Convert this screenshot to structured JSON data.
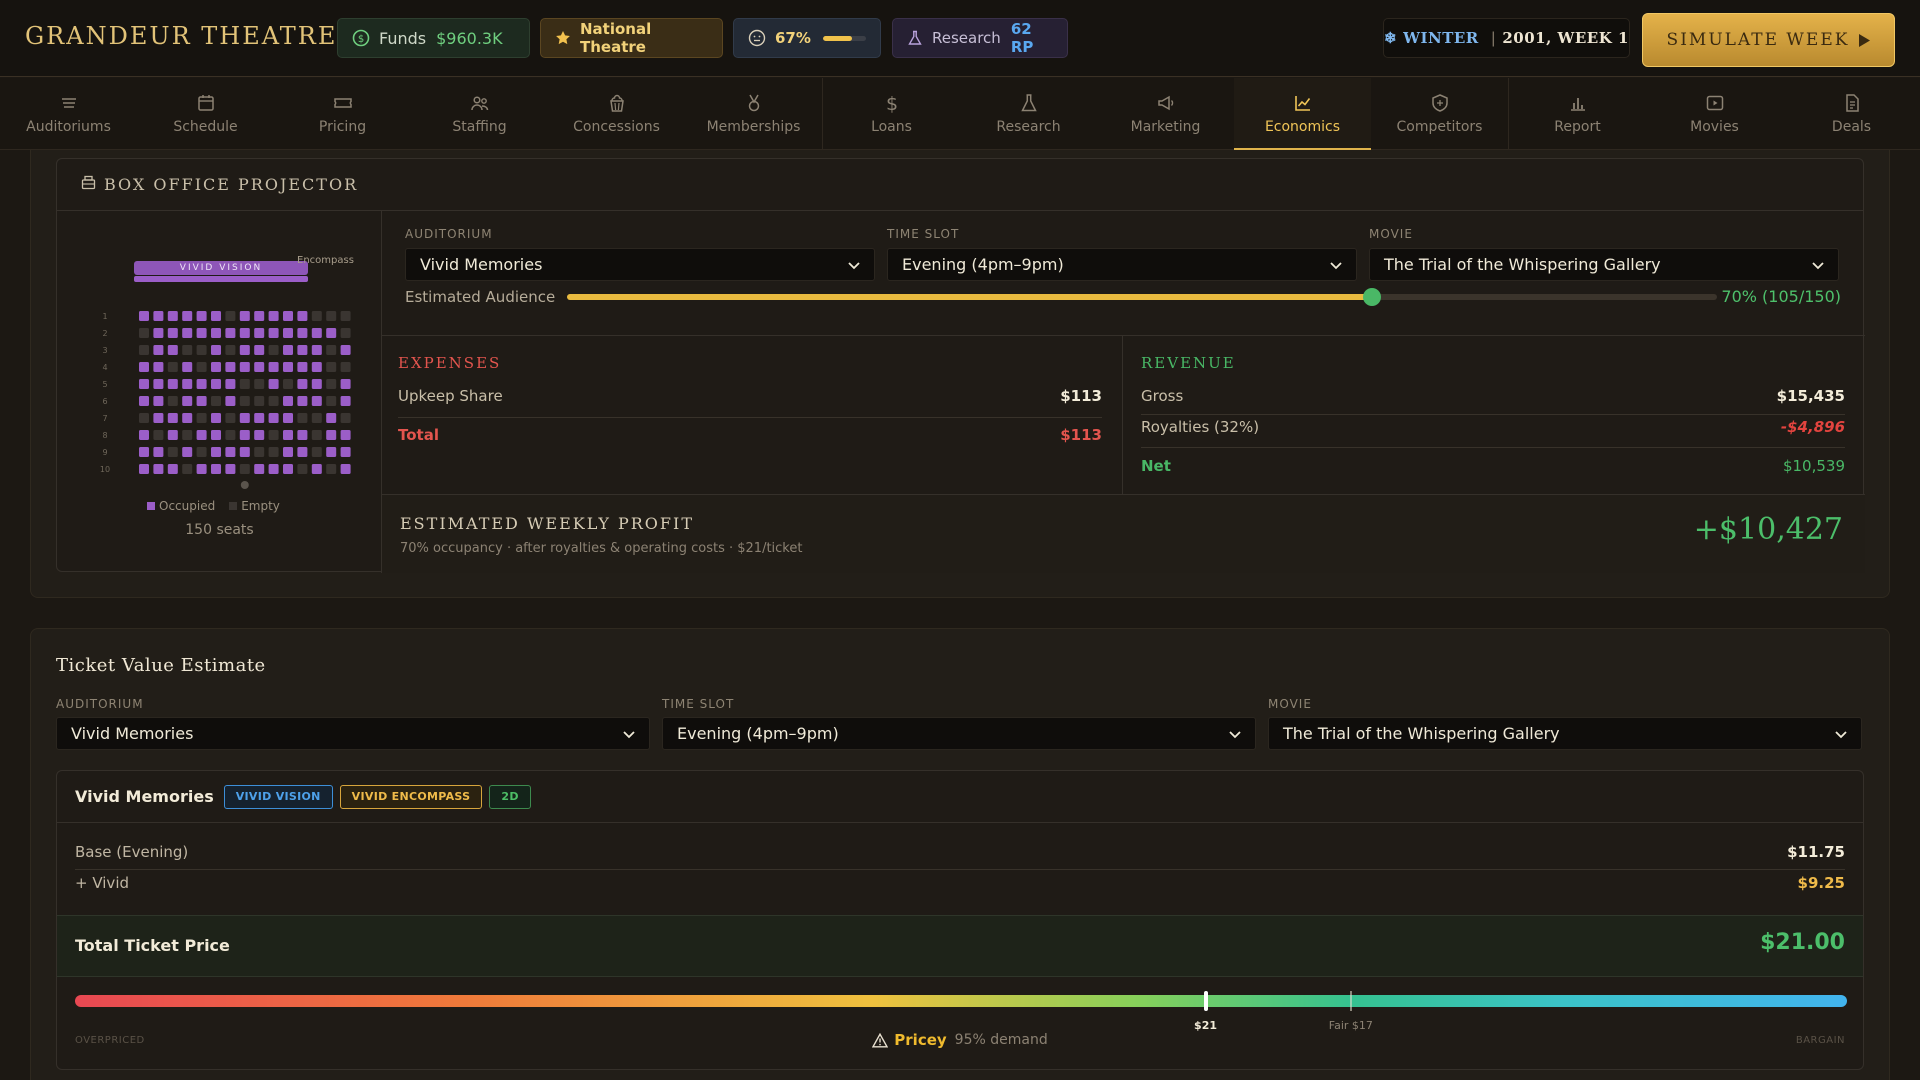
{
  "app": {
    "brand": "GRANDEUR THEATRE",
    "funds_label": "Funds",
    "funds_value": "$960.3K",
    "rank": "National Theatre",
    "satisfaction": "67%",
    "satisfaction_level": 0.67,
    "research_label": "Research",
    "research_value": "62 RP",
    "date": {
      "season": "WINTER",
      "year": "2001",
      "week": "WEEK 1"
    },
    "simulate_label": "SIMULATE WEEK"
  },
  "nav": {
    "tabs": [
      {
        "label": "Auditoriums",
        "icon": "auditorium-icon"
      },
      {
        "label": "Schedule",
        "icon": "calendar-icon"
      },
      {
        "label": "Pricing",
        "icon": "ticket-icon"
      },
      {
        "label": "Staffing",
        "icon": "people-icon"
      },
      {
        "label": "Concessions",
        "icon": "popcorn-icon"
      },
      {
        "label": "Memberships",
        "icon": "medal-icon"
      },
      {
        "label": "Loans",
        "icon": "dollar-icon"
      },
      {
        "label": "Research",
        "icon": "flask-icon"
      },
      {
        "label": "Marketing",
        "icon": "megaphone-icon"
      },
      {
        "label": "Economics",
        "icon": "chart-line-icon"
      },
      {
        "label": "Competitors",
        "icon": "shield-icon"
      },
      {
        "label": "Report",
        "icon": "bar-chart-icon"
      },
      {
        "label": "Movies",
        "icon": "play-icon"
      },
      {
        "label": "Deals",
        "icon": "document-icon"
      }
    ],
    "active": "Economics"
  },
  "box_office": {
    "title": "BOX OFFICE PROJECTOR",
    "seat_map": {
      "screen_label": "VIVID VISION",
      "side_label": "Encompass",
      "rows": [
        "1",
        "2",
        "3",
        "4",
        "5",
        "6",
        "7",
        "8",
        "9",
        "10"
      ],
      "occupied_label": "Occupied",
      "empty_label": "Empty",
      "seat_count": "150 seats",
      "occupied_color": "#9b5ec8",
      "empty_color": "#3a3531"
    },
    "auditorium_label": "AUDITORIUM",
    "auditorium_value": "Vivid Memories",
    "timeslot_label": "TIME SLOT",
    "timeslot_value": "Evening (4pm–9pm)",
    "movie_label": "MOVIE",
    "movie_value": "The Trial of the Whispering Gallery",
    "audience_label": "Estimated Audience",
    "audience_value": "70% (105/150)",
    "audience_fraction": 0.7,
    "expenses": {
      "title": "EXPENSES",
      "rows": [
        {
          "label": "Upkeep Share",
          "value": "$113"
        }
      ],
      "total_label": "Total",
      "total_value": "$113"
    },
    "revenue": {
      "title": "REVENUE",
      "gross_label": "Gross",
      "gross_value": "$15,435",
      "royalties_label": "Royalties (32%)",
      "royalties_value": "-$4,896",
      "net_label": "Net",
      "net_value": "$10,539"
    },
    "profit": {
      "title": "ESTIMATED WEEKLY PROFIT",
      "subtitle": "70% occupancy · after royalties & operating costs · $21/ticket",
      "value": "+$10,427"
    }
  },
  "ticket_value": {
    "title": "Ticket Value Estimate",
    "auditorium_label": "AUDITORIUM",
    "auditorium_value": "Vivid Memories",
    "timeslot_label": "TIME SLOT",
    "timeslot_value": "Evening (4pm–9pm)",
    "movie_label": "MOVIE",
    "movie_value": "The Trial of the Whispering Gallery",
    "name": "Vivid Memories",
    "badges": [
      "VIVID VISION",
      "VIVID ENCOMPASS",
      "2D"
    ],
    "base_label": "Base (Evening)",
    "base_value": "$11.75",
    "vivid_label": "+ Vivid",
    "vivid_value": "$9.25",
    "total_label": "Total Ticket Price",
    "total_value": "$21.00",
    "gauge": {
      "price_label": "$21",
      "price_position": 0.638,
      "fair_label": "Fair $17",
      "fair_position": 0.72,
      "left_label": "OVERPRICED",
      "right_label": "BARGAIN",
      "verdict": "Pricey",
      "demand": "95% demand"
    }
  }
}
